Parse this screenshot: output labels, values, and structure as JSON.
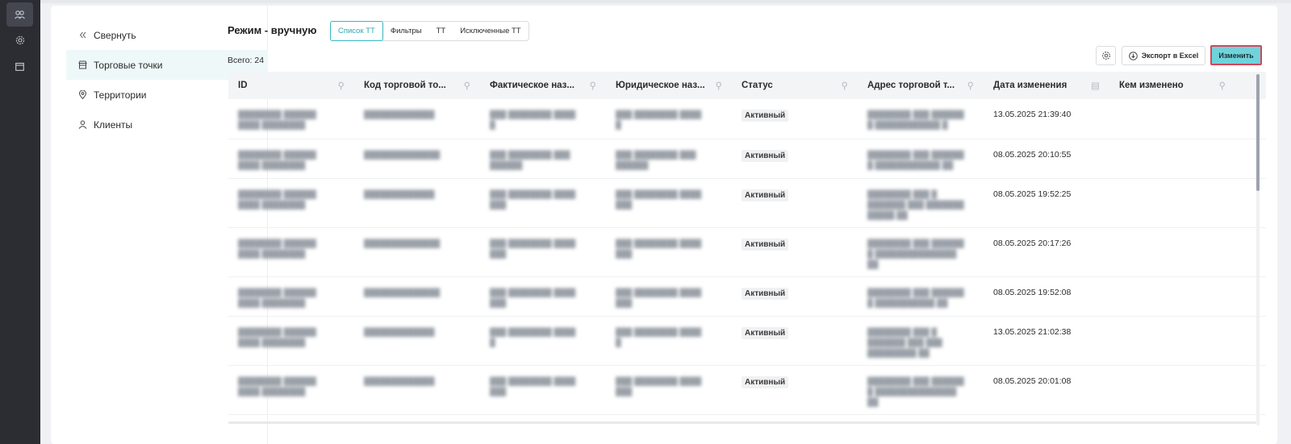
{
  "rail": {
    "icons": [
      "users-icon",
      "gear-icon",
      "calendar-icon"
    ]
  },
  "sidebar": {
    "collapse_label": "Свернуть",
    "items": [
      {
        "label": "Торговые точки",
        "icon": "store-icon",
        "active": true
      },
      {
        "label": "Территории",
        "icon": "location-pin-icon",
        "active": false
      },
      {
        "label": "Клиенты",
        "icon": "user-icon",
        "active": false
      }
    ]
  },
  "header": {
    "mode_title": "Режим - вручную",
    "tabs": [
      {
        "label": "Список ТТ",
        "active": true
      },
      {
        "label": "Фильтры",
        "active": false
      },
      {
        "label": "ТТ",
        "active": false
      },
      {
        "label": "Исключенные ТТ",
        "active": false
      }
    ],
    "total": "Всего: 24"
  },
  "toolbar": {
    "export_label": "Экспорт в Excel",
    "change_label": "Изменить"
  },
  "table": {
    "columns": [
      "ID",
      "Код торговой то...",
      "Фактическое наз...",
      "Юридическое наз...",
      "Статус",
      "Адрес торговой т...",
      "Дата изменения",
      "Кем изменено"
    ],
    "rows": [
      {
        "status": "Активный",
        "date": "13.05.2025 21:39:40"
      },
      {
        "status": "Активный",
        "date": "08.05.2025 20:10:55"
      },
      {
        "status": "Активный",
        "date": "08.05.2025 19:52:25"
      },
      {
        "status": "Активный",
        "date": "08.05.2025 20:17:26"
      },
      {
        "status": "Активный",
        "date": "08.05.2025 19:52:08"
      },
      {
        "status": "Активный",
        "date": "13.05.2025 21:02:38"
      },
      {
        "status": "Активный",
        "date": "08.05.2025 20:01:08"
      }
    ]
  },
  "colors": {
    "accent": "#36b6c0",
    "change_button_bg": "#6fd3db",
    "change_button_border": "#d6455a"
  }
}
